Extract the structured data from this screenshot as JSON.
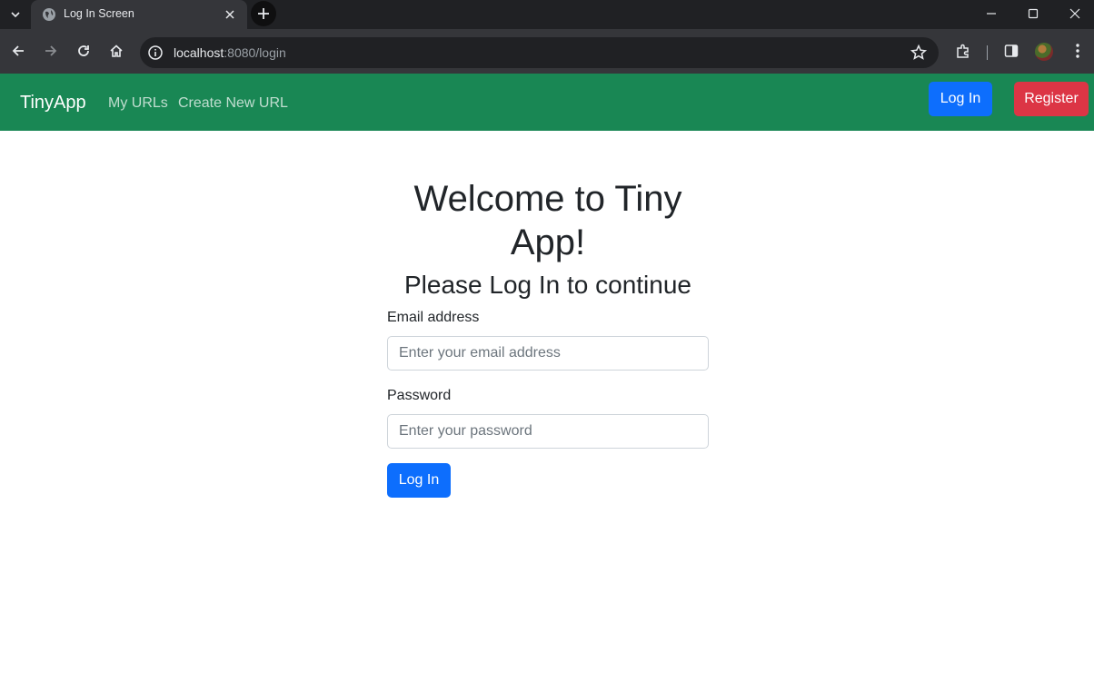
{
  "browser": {
    "tab_title": "Log In Screen",
    "url_host": "localhost",
    "url_rest": ":8080/login"
  },
  "navbar": {
    "brand": "TinyApp",
    "links": [
      "My URLs",
      "Create New URL"
    ],
    "login_label": "Log In",
    "register_label": "Register",
    "bg_color": "#198754"
  },
  "main": {
    "title": "Welcome to Tiny App!",
    "subtitle": "Please Log In to continue",
    "email_label": "Email address",
    "email_placeholder": "Enter your email address",
    "password_label": "Password",
    "password_placeholder": "Enter your password",
    "submit_label": "Log In"
  },
  "colors": {
    "primary": "#0d6efd",
    "danger": "#dc3545",
    "success": "#198754"
  },
  "icons": [
    "tab-search-icon",
    "globe-icon",
    "close-icon",
    "plus-icon",
    "minimize-icon",
    "maximize-icon",
    "back-icon",
    "forward-icon",
    "reload-icon",
    "home-icon",
    "info-icon",
    "star-icon",
    "extensions-icon",
    "side-panel-icon",
    "menu-icon"
  ]
}
